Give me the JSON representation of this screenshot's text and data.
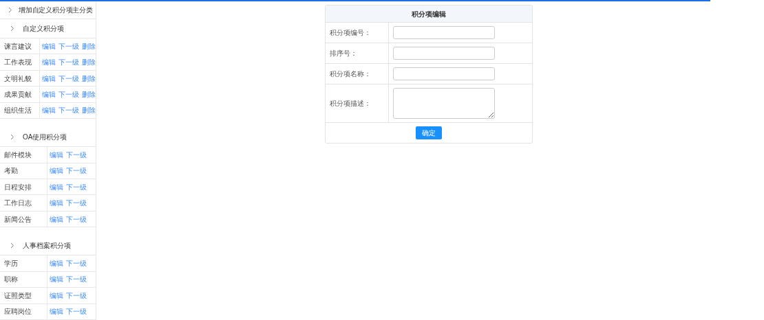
{
  "progress_bar": {
    "level": 0.93
  },
  "sidebar": {
    "add_category": "增加自定义积分项主分类",
    "groups": [
      {
        "title": "自定义积分项",
        "rows": [
          {
            "name": "谏言建议",
            "actions": [
              "编辑",
              "下一级",
              "删除"
            ]
          },
          {
            "name": "工作表现",
            "actions": [
              "编辑",
              "下一级",
              "删除"
            ]
          },
          {
            "name": "文明礼貌",
            "actions": [
              "编辑",
              "下一级",
              "删除"
            ]
          },
          {
            "name": "成果贡献",
            "actions": [
              "编辑",
              "下一级",
              "删除"
            ]
          },
          {
            "name": "组织生活",
            "actions": [
              "编辑",
              "下一级",
              "删除"
            ]
          }
        ]
      },
      {
        "title": "OA使用积分项",
        "rows": [
          {
            "name": "邮件模块",
            "actions": [
              "编辑",
              "下一级"
            ]
          },
          {
            "name": "考勤",
            "actions": [
              "编辑",
              "下一级"
            ]
          },
          {
            "name": "日程安排",
            "actions": [
              "编辑",
              "下一级"
            ]
          },
          {
            "name": "工作日志",
            "actions": [
              "编辑",
              "下一级"
            ]
          },
          {
            "name": "新闻公告",
            "actions": [
              "编辑",
              "下一级"
            ]
          }
        ]
      },
      {
        "title": "人事档案积分项",
        "rows": [
          {
            "name": "学历",
            "actions": [
              "编辑",
              "下一级"
            ]
          },
          {
            "name": "职称",
            "actions": [
              "编辑",
              "下一级"
            ]
          },
          {
            "name": "证照类型",
            "actions": [
              "编辑",
              "下一级"
            ]
          },
          {
            "name": "应聘岗位",
            "actions": [
              "编辑",
              "下一级"
            ]
          }
        ]
      }
    ]
  },
  "form": {
    "title": "积分项编辑",
    "fields": [
      {
        "kind": "input",
        "label": "积分项编号："
      },
      {
        "kind": "input",
        "label": "排序号："
      },
      {
        "kind": "input",
        "label": "积分项名称："
      },
      {
        "kind": "textarea",
        "label": "积分项描述："
      }
    ],
    "submit": "确定"
  }
}
